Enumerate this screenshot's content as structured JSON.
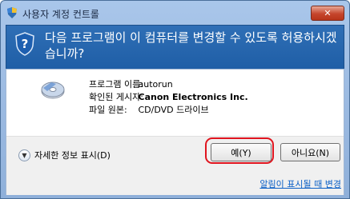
{
  "window": {
    "title": "사용자 계정 컨트롤"
  },
  "header": {
    "message": "다음 프로그램이 이 컴퓨터를 변경할 수 있도록 허용하시겠습니까?"
  },
  "program_info": {
    "rows": [
      {
        "label": "프로그램 이름:",
        "value": "autorun"
      },
      {
        "label": "확인된 게시자:",
        "value": "Canon Electronics Inc."
      },
      {
        "label": "파일 원본:",
        "value": "CD/DVD 드라이브"
      }
    ]
  },
  "footer": {
    "details_label": "자세한 정보 표시(D)",
    "yes_label": "예(Y)",
    "no_label": "아니요(N)",
    "notify_link": "알림이 표시될 때 변경"
  },
  "icons": {
    "title": "uac-shield-icon",
    "header": "question-shield-icon",
    "program": "cd-dvd-icon",
    "close": "close-icon",
    "details": "chevron-down-icon"
  },
  "colors": {
    "header_bg": "#2363ab",
    "focus_highlight": "#e0141e",
    "link": "#0a5fc6"
  }
}
